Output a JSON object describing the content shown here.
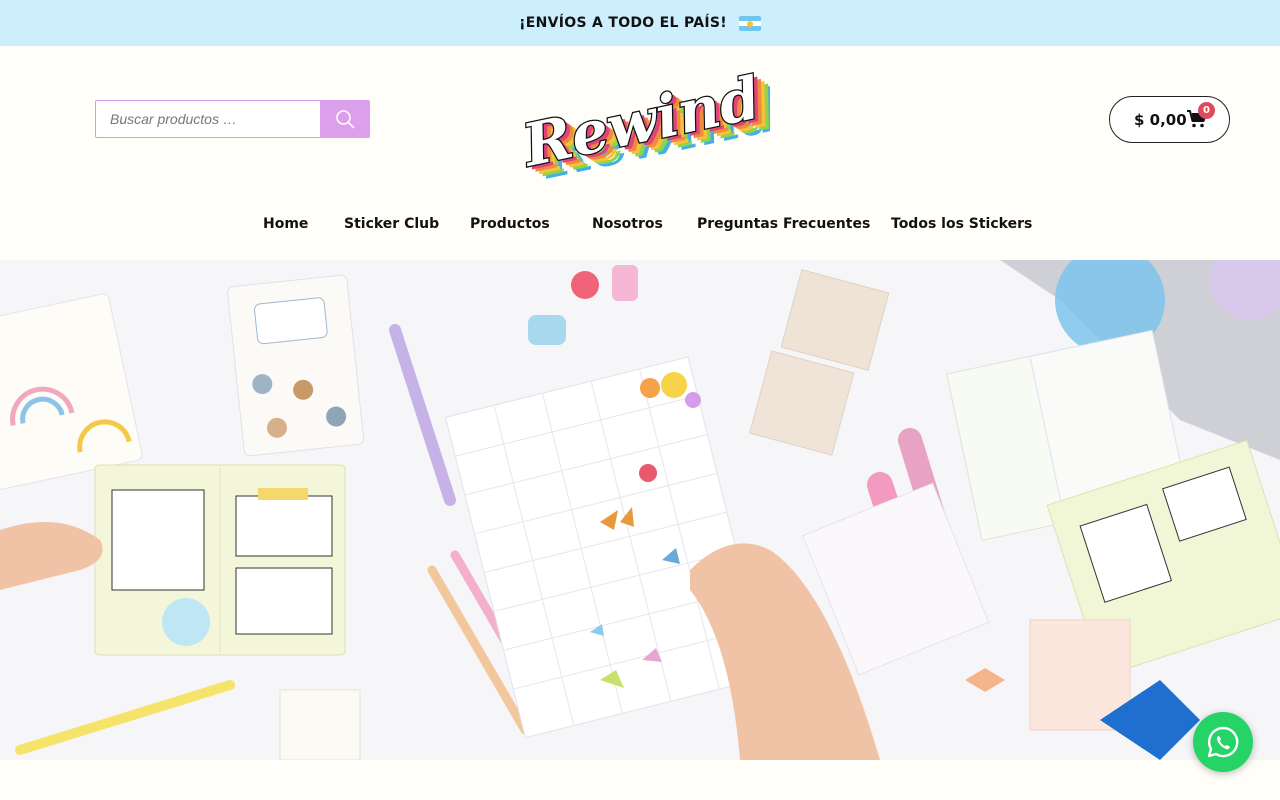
{
  "announcement": {
    "text": "¡ENVÍOS A TODO EL PAÍS!",
    "flag_icon": "argentina-flag-icon"
  },
  "search": {
    "placeholder": "Buscar productos …",
    "button_icon": "search-icon"
  },
  "logo": {
    "text": "Rewind"
  },
  "cart": {
    "total": "$ 0,00",
    "count": "0",
    "icon": "cart-icon"
  },
  "nav": {
    "items": [
      {
        "label": "Home"
      },
      {
        "label": "Sticker Club"
      },
      {
        "label": "Productos"
      },
      {
        "label": "Nosotros"
      },
      {
        "label": "Preguntas Frecuentes"
      },
      {
        "label": "Todos los Stickers"
      }
    ]
  },
  "hero": {
    "description_icon": "stationery-flatlay-image"
  },
  "whatsapp": {
    "icon": "whatsapp-icon"
  },
  "colors": {
    "announcement_bg": "#cdeefd",
    "accent": "#dc9fec",
    "badge": "#e04a5a",
    "whatsapp": "#25d366"
  }
}
